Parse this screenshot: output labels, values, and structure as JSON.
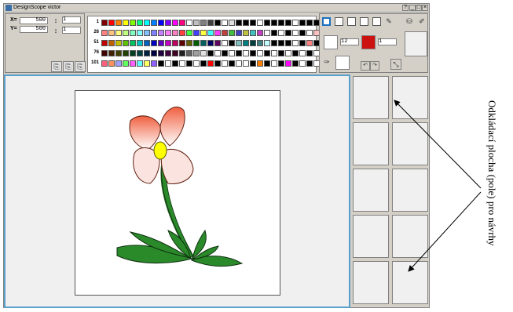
{
  "window": {
    "title": "DesignScope victor",
    "buttons": [
      "?",
      "_",
      "□",
      "×"
    ]
  },
  "coords": {
    "x_label": "X=",
    "x_value": "500",
    "y_label": "Y=",
    "y_value": "500",
    "field1_value": "1",
    "field2_value": "1"
  },
  "palette": {
    "row_labels": [
      "1",
      "26",
      "51",
      "76",
      "101"
    ],
    "rows": [
      [
        "#800000",
        "#ff0000",
        "#ff8000",
        "#ffff00",
        "#80ff00",
        "#00ff80",
        "#00ffff",
        "#0080ff",
        "#0000ff",
        "#8000ff",
        "#ff00ff",
        "#ff0080",
        "#ffffff",
        "#c0c0c0",
        "#808080",
        "#404040",
        "#000000",
        "#ffffff",
        "#e0e0e0",
        "#000000",
        "#000000",
        "#000000",
        "#ffffff",
        "#000000",
        "#000000",
        "#000000",
        "#000000",
        "#ffffff",
        "#000000",
        "#000000",
        "#000000"
      ],
      [
        "#ff8080",
        "#ffc080",
        "#ffff80",
        "#c0ff80",
        "#80ffc0",
        "#80ffff",
        "#80c0ff",
        "#8080ff",
        "#c080ff",
        "#ff80ff",
        "#ff80c0",
        "#ff4040",
        "#40ff40",
        "#4040ff",
        "#ffff40",
        "#40ffff",
        "#ff40ff",
        "#c04040",
        "#40c040",
        "#4040c0",
        "#c0c040",
        "#40c0c0",
        "#c040c0",
        "#ffffff",
        "#000000",
        "#ffffff",
        "#000000",
        "#ffffff",
        "#000000",
        "#ffffff",
        "#ffc0c0"
      ],
      [
        "#c00000",
        "#c06000",
        "#c0c000",
        "#60c000",
        "#00c060",
        "#00c0c0",
        "#0060c0",
        "#0000c0",
        "#6000c0",
        "#c000c0",
        "#c00060",
        "#600000",
        "#606000",
        "#006000",
        "#006060",
        "#000060",
        "#600060",
        "#ffffff",
        "#000000",
        "#80c0c0",
        "#008080",
        "#004040",
        "#408080",
        "#c0ffff",
        "#000000",
        "#000000",
        "#000000",
        "#ffffff",
        "#000000",
        "#ff8080",
        "#000000"
      ],
      [
        "#400000",
        "#402000",
        "#404000",
        "#204000",
        "#004020",
        "#004040",
        "#002040",
        "#000040",
        "#200040",
        "#400040",
        "#400020",
        "#202020",
        "#606060",
        "#a0a0a0",
        "#e0e0e0",
        "#000000",
        "#ffffff",
        "#000000",
        "#ffffff",
        "#000000",
        "#ffffff",
        "#000000",
        "#ffffff",
        "#000000",
        "#ffffff",
        "#000000",
        "#ffffff",
        "#000000",
        "#ffffff",
        "#000000",
        "#ffffff"
      ],
      [
        "#ff6080",
        "#ff9060",
        "#a0a0ff",
        "#60ff60",
        "#ff60ff",
        "#60ffff",
        "#ffff60",
        "#9060ff",
        "#000000",
        "#ffffff",
        "#000000",
        "#ffffff",
        "#000000",
        "#ffffff",
        "#000000",
        "#ff0000",
        "#000000",
        "#ffffff",
        "#000000",
        "#ffffff",
        "#ffffff",
        "#000000",
        "#ff8000",
        "#000000",
        "#ffffff",
        "#000000",
        "#ff00ff",
        "#000000",
        "#ffffff",
        "#000000",
        "#ffffff"
      ]
    ]
  },
  "brush": {
    "size_value": "12",
    "count_value": "1",
    "stroke_color": "#cc1111",
    "fill_color": "#ffffff"
  },
  "annotation": {
    "text": "Odkládací plocha (pole) pro návrhy"
  }
}
